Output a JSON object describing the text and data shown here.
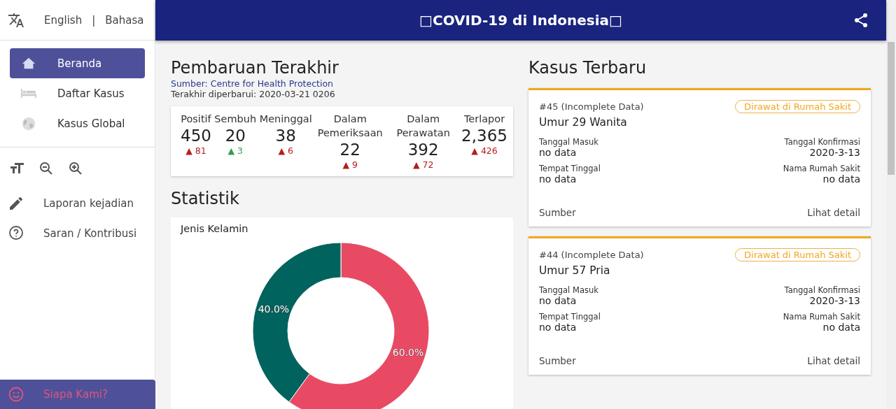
{
  "sidebar": {
    "languages": [
      "English",
      "|",
      "Bahasa"
    ],
    "nav": [
      {
        "label": "Beranda",
        "selected": true
      },
      {
        "label": "Daftar Kasus",
        "selected": false
      },
      {
        "label": "Kasus Global",
        "selected": false
      }
    ],
    "links": [
      "Laporan kejadian",
      "Saran / Kontribusi"
    ],
    "about": "Siapa Kami?"
  },
  "header": {
    "title": "□COVID-19 di Indonesia□"
  },
  "update": {
    "title": "Pembaruan Terakhir",
    "source": "Sumber: Centre for Health Protection",
    "updated": "Terakhir diperbarui: 2020-03-21 0206",
    "stats": [
      {
        "label": "Positif",
        "value": "450",
        "delta": "▲ 81",
        "color": "#b71c1c"
      },
      {
        "label": "Sembuh",
        "value": "20",
        "delta": "▲ 3",
        "color": "#2e9e4f"
      },
      {
        "label": "Meninggal",
        "value": "38",
        "delta": "▲ 6",
        "color": "#b71c1c"
      },
      {
        "label": "Dalam Pemeriksaan",
        "value": "22",
        "delta": "▲ 9",
        "color": "#b71c1c"
      },
      {
        "label": "Dalam Perawatan",
        "value": "392",
        "delta": "▲ 72",
        "color": "#b71c1c"
      },
      {
        "label": "Terlapor",
        "value": "2,365",
        "delta": "▲ 426",
        "color": "#b71c1c"
      }
    ]
  },
  "statistics": {
    "title": "Statistik",
    "chart_title": "Jenis Kelamin",
    "chart_data": {
      "type": "donut",
      "values": [
        60,
        40
      ],
      "colors": [
        "#e84a64",
        "#00635d"
      ],
      "value_labels": [
        "60.0%",
        "40.0%"
      ]
    }
  },
  "cases": {
    "title": "Kasus Terbaru",
    "items": [
      {
        "number": "#45 (Incomplete Data)",
        "status": "Dirawat di Rumah Sakit",
        "title": "Umur 29 Wanita",
        "fields": [
          {
            "label": "Tanggal Masuk",
            "value": "no data"
          },
          {
            "label": "Tanggal Konfirmasi",
            "value": "2020-3-13"
          },
          {
            "label": "Tempat Tinggal",
            "value": "no data"
          },
          {
            "label": "Nama Rumah Sakit",
            "value": "no data"
          }
        ],
        "source": "Sumber",
        "detail": "Lihat detail"
      },
      {
        "number": "#44 (Incomplete Data)",
        "status": "Dirawat di Rumah Sakit",
        "title": "Umur 57 Pria",
        "fields": [
          {
            "label": "Tanggal Masuk",
            "value": "no data"
          },
          {
            "label": "Tanggal Konfirmasi",
            "value": "2020-3-13"
          },
          {
            "label": "Tempat Tinggal",
            "value": "no data"
          },
          {
            "label": "Nama Rumah Sakit",
            "value": "no data"
          }
        ],
        "source": "Sumber",
        "detail": "Lihat detail"
      }
    ]
  }
}
